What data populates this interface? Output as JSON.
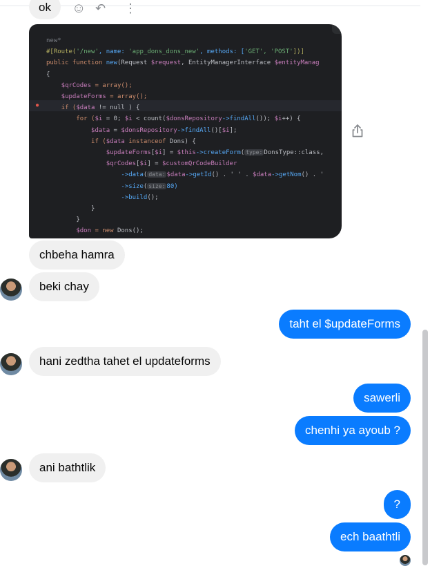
{
  "messages": {
    "ok": "ok",
    "chbeha": "chbeha hamra",
    "beki": "beki chay",
    "taht": "taht el $updateForms",
    "hani": "hani zedtha tahet el updateforms",
    "sawerli": "sawerli",
    "chenhi": "chenhi ya ayoub ?",
    "ani": "ani bathtlik",
    "question": "?",
    "ech": "ech baathtli"
  },
  "code": {
    "tab": "new",
    "line1a": "#[Route(",
    "line1b": "'/new'",
    "line1c": ", name: ",
    "line1d": "'app_dons_dons_new'",
    "line1e": ", methods: [",
    "line1f": "'GET', 'POST'",
    "line1g": "])]",
    "line2a": "public function ",
    "line2b": "new",
    "line2c": "(Request ",
    "line2d": "$request",
    "line2e": ", EntityManagerInterface ",
    "line2f": "$entityManag",
    "line3": "{",
    "line4a": "    $qrCodes",
    "line4b": " = array();",
    "line5a": "    $updateForms",
    "line5b": " = array();",
    "line6a": "    if (",
    "line6b": "$data",
    "line6c": " != null ) {",
    "line7a": "        for (",
    "line7b": "$i",
    "line7c": " = 0; ",
    "line7d": "$i",
    "line7e": " < count(",
    "line7f": "$donsRepository",
    "line7g": "->findAll",
    "line7h": "()); ",
    "line7i": "$i",
    "line7j": "++) {",
    "line8a": "            $data",
    "line8b": " = ",
    "line8c": "$donsRepository",
    "line8d": "->findAll",
    "line8e": "()[",
    "line8f": "$i",
    "line8g": "];",
    "line9a": "            if (",
    "line9b": "$data",
    "line9c": " instanceof ",
    "line9d": "Dons) {",
    "line10a": "                $updateForms",
    "line10b": "[",
    "line10c": "$i",
    "line10d": "] = ",
    "line10e": "$this",
    "line10f": "->createForm",
    "line10g": "(",
    "line10h": "type:",
    "line10i": "DonsType::class,",
    "line11a": "                $qrCodes",
    "line11b": "[",
    "line11c": "$i",
    "line11d": "] = ",
    "line11e": "$customQrCodeBuilder",
    "line12a": "                    ->data",
    "line12b": "(",
    "line12c": "data:",
    "line12d": "$data",
    "line12e": "->getId",
    "line12f": "() . ' ' . ",
    "line12g": "$data",
    "line12h": "->getNom",
    "line12i": "() . '",
    "line13a": "                    ->size",
    "line13b": "(",
    "line13c": "size:",
    "line13d": "80)",
    "line14a": "                    ->build",
    "line14b": "();",
    "line15": "            }",
    "line16": "        }",
    "line17a": "        $don",
    "line17b": " = new ",
    "line17c": "Dons();"
  },
  "icons": {
    "emoji": "smiley-icon",
    "reply": "reply-icon",
    "more": "more-icon",
    "share": "share-icon",
    "warning": "bulb-icon"
  },
  "colors": {
    "outgoing": "#0a7cff",
    "incoming": "#f0f0f0"
  }
}
